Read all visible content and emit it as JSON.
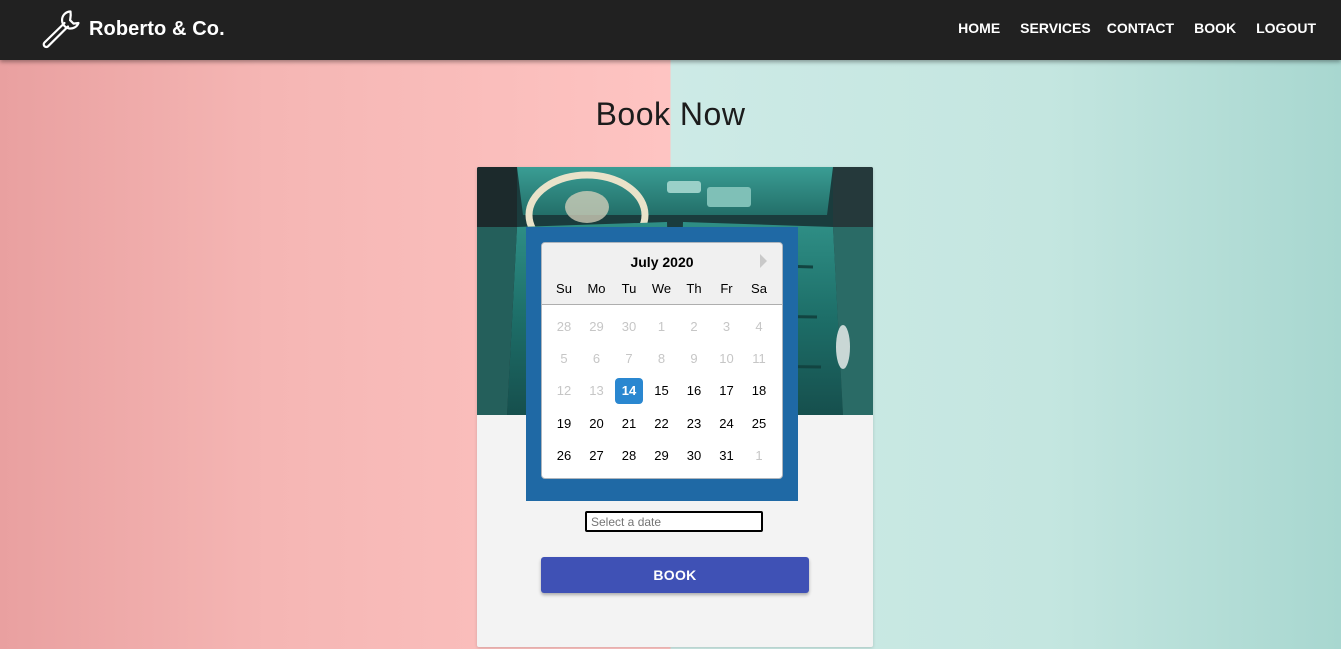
{
  "nav": {
    "brand_icon": "wrench-icon",
    "brand_name": "Roberto & Co.",
    "links": [
      "HOME",
      "SERVICES",
      "CONTACT",
      "BOOK",
      "LOGOUT"
    ]
  },
  "page": {
    "title": "Book Now"
  },
  "card": {
    "image": "car-interior-photo"
  },
  "datepicker": {
    "month_label": "July 2020",
    "next_icon": "triangle-right-icon",
    "weekdays": [
      "Su",
      "Mo",
      "Tu",
      "We",
      "Th",
      "Fr",
      "Sa"
    ],
    "weeks": [
      [
        "28",
        "29",
        "30",
        "1",
        "2",
        "3",
        "4"
      ],
      [
        "5",
        "6",
        "7",
        "8",
        "9",
        "10",
        "11"
      ],
      [
        "12",
        "13",
        "14",
        "15",
        "16",
        "17",
        "18"
      ],
      [
        "19",
        "20",
        "21",
        "22",
        "23",
        "24",
        "25"
      ],
      [
        "26",
        "27",
        "28",
        "29",
        "30",
        "31",
        "1"
      ]
    ],
    "selected_day": "14",
    "disabled_days_before_selected": true
  },
  "form": {
    "date_placeholder": "Select a date",
    "date_value": "",
    "book_label": "BOOK"
  },
  "colors": {
    "navbar": "#212121",
    "datepicker_bg": "#1f69a5",
    "selected_day": "#2a87d0",
    "book_button": "#3f51b5",
    "muted_day": "#c6c6c6"
  }
}
